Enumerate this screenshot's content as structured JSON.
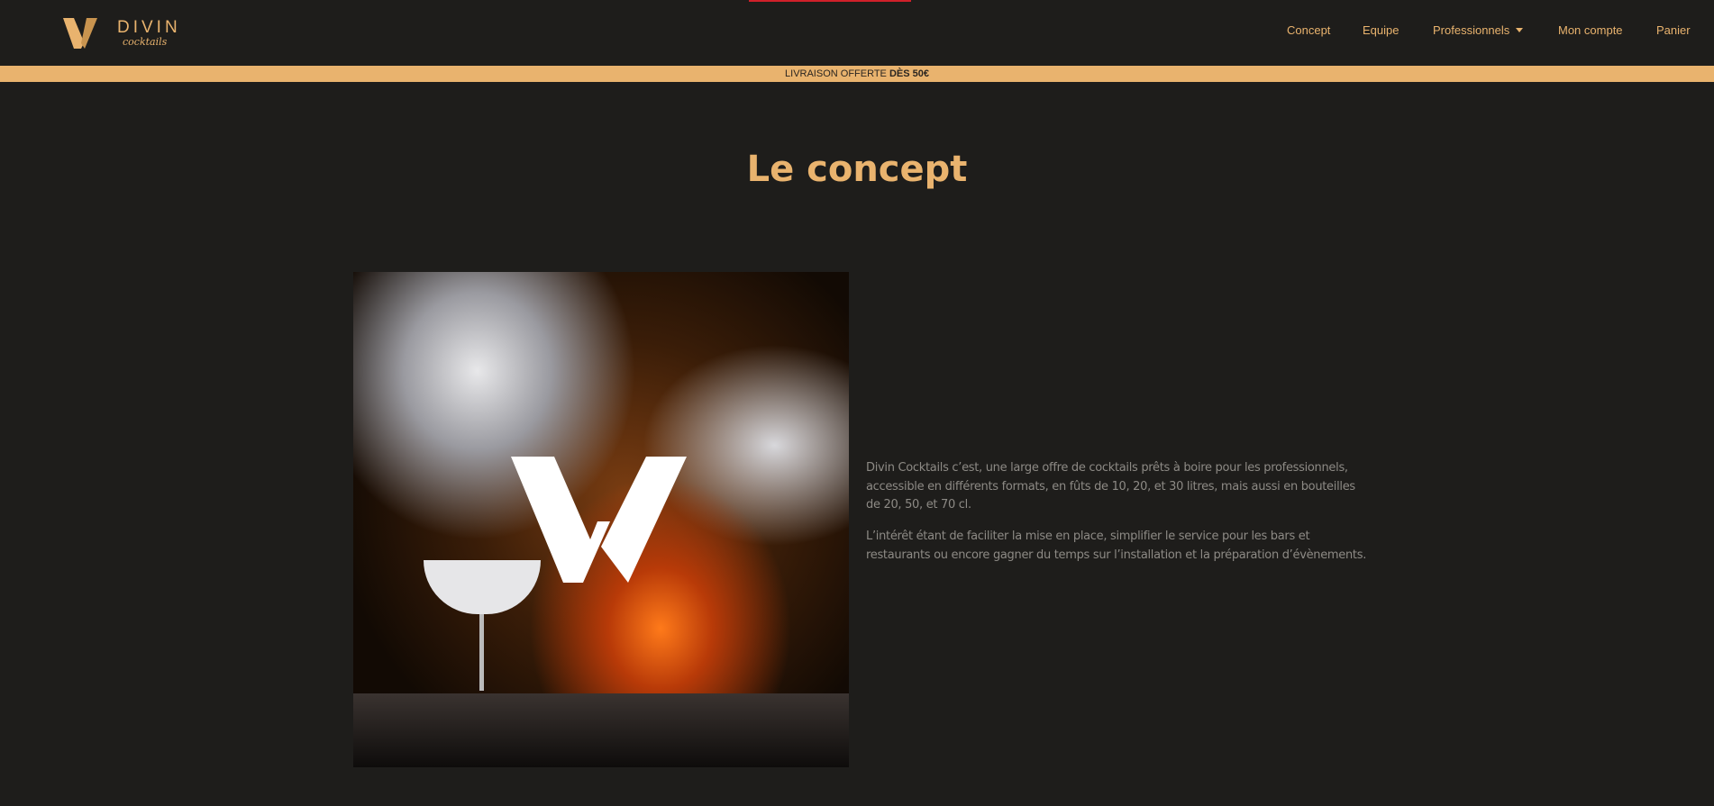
{
  "brand": {
    "name": "DIVIN",
    "sub": "cocktails",
    "accent": "#e9b36e",
    "background": "#1e1d1b"
  },
  "nav": {
    "items": [
      {
        "label": "Concept"
      },
      {
        "label": "Equipe"
      },
      {
        "label": "Professionnels",
        "icon": "caret-down-icon"
      },
      {
        "label": "Mon compte"
      },
      {
        "label": "Panier"
      }
    ]
  },
  "banner": {
    "text": "LIVRAISON OFFERTE ",
    "bold": "DÈS 50€"
  },
  "main": {
    "title": "Le concept",
    "paragraphs": [
      "Divin Cocktails c’est, une large offre de cocktails prêts à boire pour les professionnels, accessible en différents formats, en fûts de 10, 20, et 30 litres, mais aussi en bouteilles de 20, 50, et 70 cl.",
      "L’intérêt étant de faciliter la mise en place, simplifier le service pour les bars et restaurants ou encore gagner du temps sur l’installation et la préparation d’évènements."
    ]
  }
}
